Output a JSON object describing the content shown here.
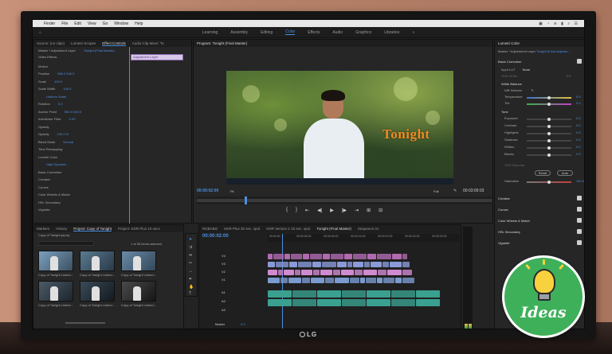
{
  "os_menu": {
    "apple": "",
    "items": [
      "Finder",
      "File",
      "Edit",
      "View",
      "Go",
      "Window",
      "Help"
    ]
  },
  "workspaces": {
    "items": [
      "Learning",
      "Assembly",
      "Editing",
      "Color",
      "Effects",
      "Audio",
      "Graphics",
      "Libraries"
    ],
    "active": "Color"
  },
  "effect_controls": {
    "tabs": [
      "Source: (no clips)",
      "Lumetri Scopes",
      "Effect Controls",
      "Audio Clip Mixer: To"
    ],
    "active_tab": "Effect Controls",
    "master": "Master * Adjustment Layer",
    "sequence": "Tonight (Final Master)",
    "clip": "Adjustment Layer",
    "section": "Video Effects",
    "rows": [
      {
        "label": "Motion",
        "value": ""
      },
      {
        "label": "Position",
        "value": "960.0  540.0"
      },
      {
        "label": "Scale",
        "value": "100.0"
      },
      {
        "label": "Scale Width",
        "value": "100.0"
      },
      {
        "label": "",
        "value": "Uniform Scale"
      },
      {
        "label": "Rotation",
        "value": "0.0"
      },
      {
        "label": "Anchor Point",
        "value": "960.0  540.0"
      },
      {
        "label": "Anti-flicker Filter",
        "value": "0.00"
      },
      {
        "label": "Opacity",
        "value": ""
      },
      {
        "label": "Opacity",
        "value": "100.0 %"
      },
      {
        "label": "Blend Mode",
        "value": "Normal"
      },
      {
        "label": "Time Remapping",
        "value": ""
      },
      {
        "label": "Lumetri Color",
        "value": ""
      },
      {
        "label": "",
        "value": "High Dynamic..."
      },
      {
        "label": "Basic Correction",
        "value": ""
      },
      {
        "label": "Creative",
        "value": ""
      },
      {
        "label": "Curves",
        "value": ""
      },
      {
        "label": "Color Wheels & Match",
        "value": ""
      },
      {
        "label": "HSL Secondary",
        "value": ""
      },
      {
        "label": "Vignette",
        "value": ""
      }
    ]
  },
  "program_monitor": {
    "title": "Program: Tonight (Final Master)",
    "overlay_title": "Tonight",
    "timecode_left": "00:00:02:00",
    "fit": "Fit",
    "full": "Full",
    "timecode_right": "00:03:09:03",
    "transport": [
      "{",
      "}",
      "⇤",
      "◀|",
      "▶",
      "|▶",
      "⇥",
      "⊞",
      "⊟"
    ]
  },
  "project_panel": {
    "tabs": [
      "Markers",
      "History",
      "Project: Copy of Tonight",
      "Project: KDR Plus 10 secs"
    ],
    "active_tab": "Project: Copy of Tonight",
    "project_file": "Copy of Tonight.prproj",
    "items_selected": "1 of 35 items selected",
    "items": [
      "Copy of Tonight Linked...",
      "Copy of Tonight Linked...",
      "Copy of Tonight Linked...",
      "Copy of Tonight Linked...",
      "Copy of Tonight Linked...",
      "Copy of Tonight Linked..."
    ]
  },
  "timeline": {
    "tabs": [
      "RGBABG",
      "KDR Plus 30 sec. spot",
      "KDR Version 2 15 sec. spot",
      "Tonight (Final Master)",
      "Sequence 01"
    ],
    "active_tab": "Tonight (Final Master)",
    "timecode": "00:00:02:00",
    "ruler": [
      "00:00:00",
      "00:00:04:23",
      "00:00:09:23",
      "00:00:14:23",
      "00:00:19:23",
      "00:00:24:23",
      "00:00:29:23"
    ],
    "tracks_video": [
      "V4",
      "V3",
      "V2",
      "V1"
    ],
    "tracks_audio": [
      "A1",
      "A2",
      "A3"
    ],
    "master": "Master",
    "master_value": "0.0"
  },
  "lumetri": {
    "title": "Lumetri Color",
    "master": "Master * Adjustment Layer",
    "sequence": "Tonight (Final Adjustm...",
    "section_basic": "Basic Correction",
    "input_lut": "Input LUT",
    "input_lut_value": "None",
    "hdr_white": "HDR White",
    "hdr_white_value": "100",
    "white_balance": "White Balance",
    "wb_selector": "WB Selector",
    "temperature": "Temperature",
    "temperature_value": "0.0",
    "tint": "Tint",
    "tint_value": "0.0",
    "tone": "Tone",
    "tone_rows": [
      {
        "label": "Exposure",
        "value": "0.0",
        "knob": 0.5
      },
      {
        "label": "Contrast",
        "value": "0.0",
        "knob": 0.5
      },
      {
        "label": "Highlights",
        "value": "0.0",
        "knob": 0.5
      },
      {
        "label": "Shadows",
        "value": "0.0",
        "knob": 0.5
      },
      {
        "label": "Whites",
        "value": "0.0",
        "knob": 0.5
      },
      {
        "label": "Blacks",
        "value": "0.0",
        "knob": 0.5
      }
    ],
    "hdr_specular": "HDR Specular",
    "reset": "Reset",
    "auto": "Auto",
    "saturation": "Saturation",
    "saturation_value": "100.0",
    "sections": [
      "Creative",
      "Curves",
      "Color Wheels & Match",
      "HSL Secondary",
      "Vignette"
    ]
  },
  "monitor_brand": "LG",
  "badge": {
    "text": "Ideas",
    "bg_color": "#3fb05a",
    "icon": "lightbulb-icon"
  },
  "colors": {
    "accent_blue": "#4a90e2",
    "title_orange": "#f08a1e"
  }
}
